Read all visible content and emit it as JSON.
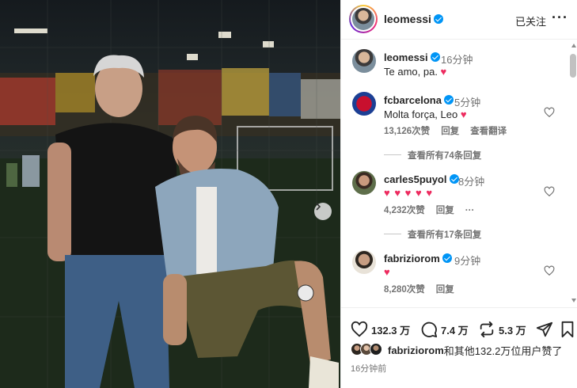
{
  "post": {
    "header": {
      "username": "leomessi",
      "follow_status": "已关注",
      "more_icon": "···"
    },
    "caption": {
      "username": "leomessi",
      "time": "16分钟",
      "text": "Te amo, pa. ",
      "emoji": "♥"
    },
    "comments": [
      {
        "username": "fcbarcelona",
        "time": "5分钟",
        "text": "Molta força, Leo ",
        "emoji": "♥",
        "likes": "13,126次赞",
        "reply_label": "回复",
        "translate_label": "查看翻译",
        "view_replies": "查看所有74条回复",
        "avatar_color": "#a50044"
      },
      {
        "username": "carles5puyol",
        "time": "8分钟",
        "emoji": "♥ ♥ ♥ ♥ ♥",
        "likes": "4,232次赞",
        "reply_label": "回复",
        "more_icon": "···",
        "view_replies": "查看所有17条回复",
        "avatar_color": "#7a5c45"
      },
      {
        "username": "fabriziorom",
        "time": "9分钟",
        "emoji": "♥",
        "likes": "8,280次赞",
        "reply_label": "回复",
        "avatar_color": "#5b4a3c"
      }
    ],
    "actions": {
      "likes_count": "132.3 万",
      "comments_count": "7.4 万",
      "reposts_count": "5.3 万"
    },
    "liked_by": {
      "username": "fabriziorom",
      "rest": "和其他132.2万位用户赞了"
    },
    "post_time": "16分钟前"
  },
  "colors": {
    "verified": "#0095f6",
    "heart": "#ed2b5f",
    "secondary_text": "#737373"
  }
}
